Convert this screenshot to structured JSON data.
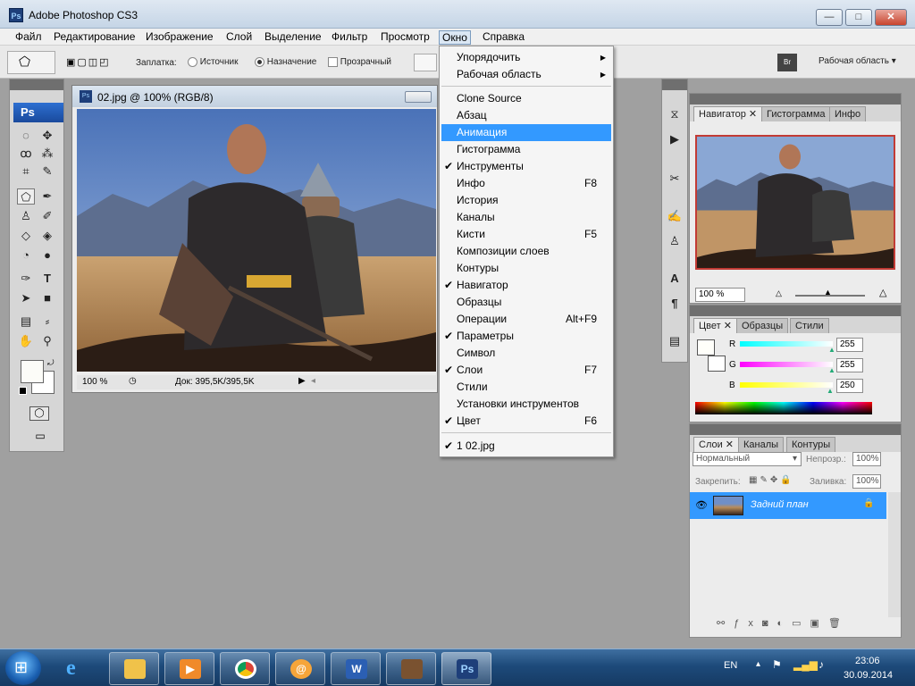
{
  "app": {
    "title": "Adobe Photoshop CS3",
    "logo": "Ps"
  },
  "window_controls": {
    "minimize": "—",
    "maximize": "□",
    "close": "✕"
  },
  "menubar": [
    "Файл",
    "Редактирование",
    "Изображение",
    "Слой",
    "Выделение",
    "Фильтр",
    "Просмотр",
    "Окно",
    "Справка"
  ],
  "active_menu": "Окно",
  "options_bar": {
    "patch_label": "Заплатка:",
    "source": "Источник",
    "destination": "Назначение",
    "transparent": "Прозрачный",
    "workspace": "Рабочая область"
  },
  "toolbox": {
    "logo": "Ps"
  },
  "document": {
    "title": "02.jpg @ 100% (RGB/8)",
    "zoom": "100 %",
    "doc_info": "Док: 395,5K/395,5K"
  },
  "window_menu": {
    "items": [
      {
        "label": "Упорядочить",
        "submenu": true
      },
      {
        "label": "Рабочая область",
        "submenu": true
      },
      {
        "sep": true
      },
      {
        "label": "Clone Source"
      },
      {
        "label": "Абзац"
      },
      {
        "label": "Анимация",
        "highlighted": true
      },
      {
        "label": "Гистограмма"
      },
      {
        "label": "Инструменты",
        "checked": true
      },
      {
        "label": "Инфо",
        "shortcut": "F8"
      },
      {
        "label": "История"
      },
      {
        "label": "Каналы"
      },
      {
        "label": "Кисти",
        "shortcut": "F5"
      },
      {
        "label": "Композиции слоев"
      },
      {
        "label": "Контуры"
      },
      {
        "label": "Навигатор",
        "checked": true
      },
      {
        "label": "Образцы"
      },
      {
        "label": "Операции",
        "shortcut": "Alt+F9"
      },
      {
        "label": "Параметры",
        "checked": true
      },
      {
        "label": "Символ"
      },
      {
        "label": "Слои",
        "checked": true,
        "shortcut": "F7"
      },
      {
        "label": "Стили"
      },
      {
        "label": "Установки инструментов"
      },
      {
        "label": "Цвет",
        "checked": true,
        "shortcut": "F6"
      },
      {
        "sep": true
      },
      {
        "label": "1 02.jpg",
        "checked": true
      }
    ]
  },
  "navigator_panel": {
    "tabs": [
      "Навигатор",
      "Гистограмма",
      "Инфо"
    ],
    "zoom": "100 %"
  },
  "color_panel": {
    "tabs": [
      "Цвет",
      "Образцы",
      "Стили"
    ],
    "channels": [
      {
        "name": "R",
        "value": "255",
        "fill": 1.0
      },
      {
        "name": "G",
        "value": "255",
        "fill": 1.0
      },
      {
        "name": "B",
        "value": "250",
        "fill": 0.98
      }
    ]
  },
  "layers_panel": {
    "tabs": [
      "Слои",
      "Каналы",
      "Контуры"
    ],
    "blend_mode": "Нормальный",
    "opacity_label": "Непрозр.:",
    "opacity": "100%",
    "lock_label": "Закрепить:",
    "fill_label": "Заливка:",
    "fill": "100%",
    "layer_name": "Задний план"
  },
  "taskbar": {
    "lang": "EN",
    "time": "23:06",
    "date": "30.09.2014"
  },
  "colors": {
    "highlight": "#3399ff",
    "layer_selected": "#3399ff"
  }
}
